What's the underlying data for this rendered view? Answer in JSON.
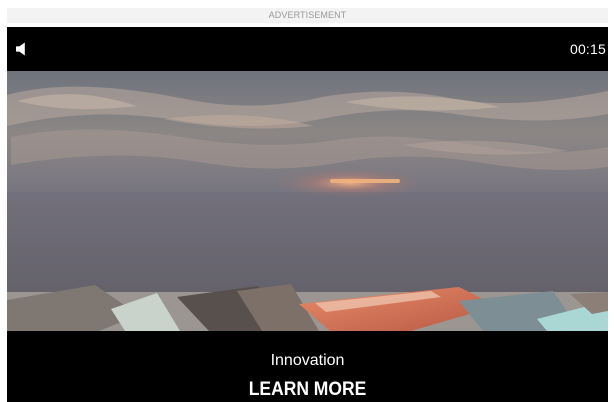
{
  "ad": {
    "label": "ADVERTISEMENT"
  },
  "player": {
    "mute_icon": "speaker-icon",
    "timer": "00:15",
    "headline": "Innovation",
    "cta_label": "LEARN MORE"
  },
  "colors": {
    "background": "#ffffff",
    "ad_label_bg": "#f3f3f3",
    "ad_label_text": "#9a9a9a",
    "player_bg": "#000000",
    "player_text": "#ffffff"
  }
}
